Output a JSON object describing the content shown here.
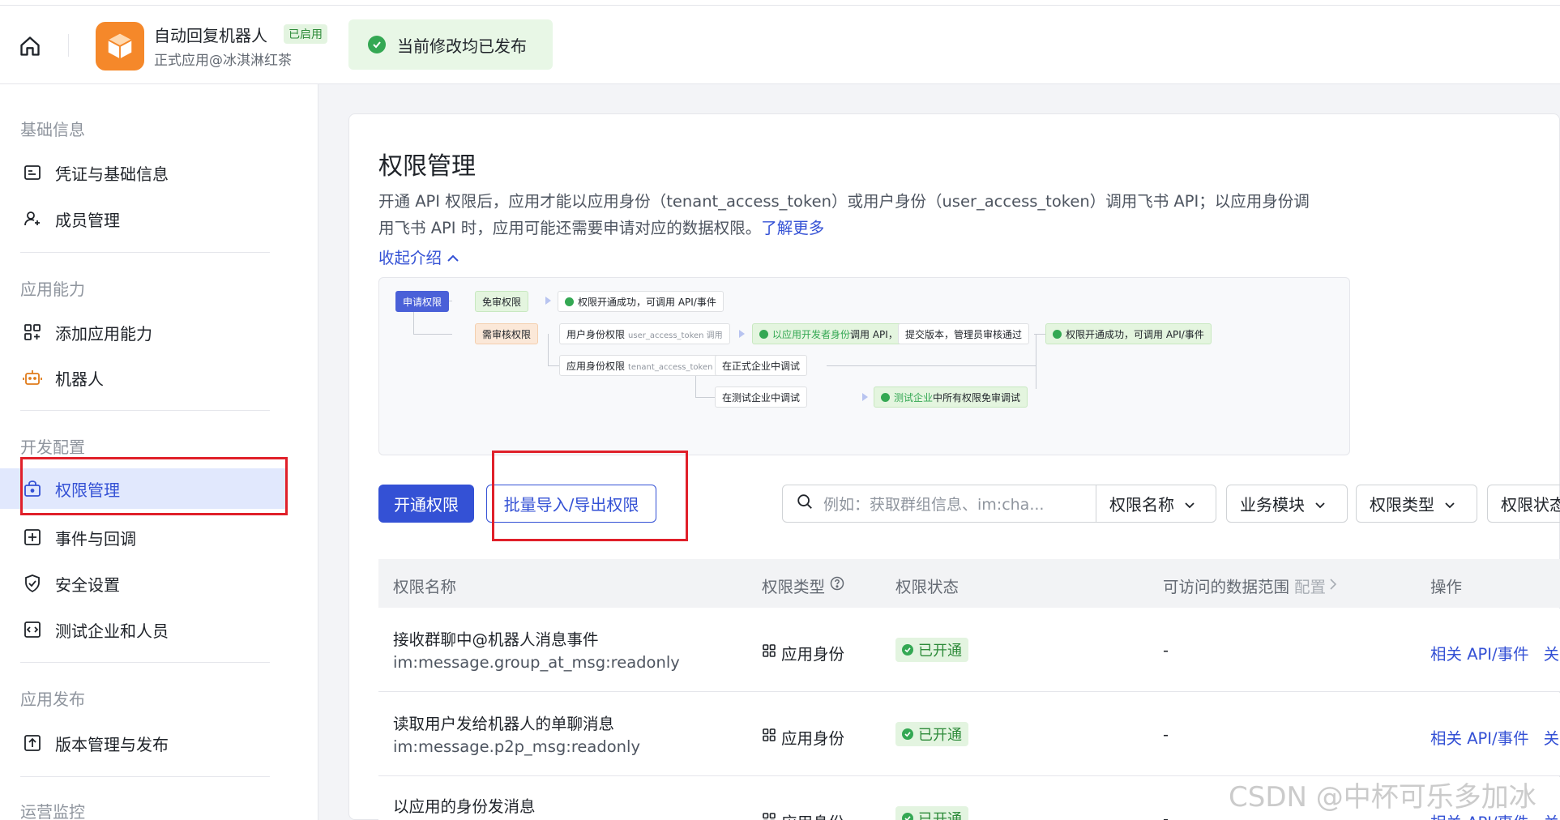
{
  "header": {
    "app_name": "自动回复机器人",
    "app_badge": "已启用",
    "app_owner": "正式应用@冰淇淋红茶",
    "publish_status": "当前修改均已发布"
  },
  "sidebar": {
    "groups": [
      {
        "label": "基础信息",
        "items": [
          {
            "label": "凭证与基础信息"
          },
          {
            "label": "成员管理"
          }
        ]
      },
      {
        "label": "应用能力",
        "items": [
          {
            "label": "添加应用能力"
          },
          {
            "label": "机器人"
          }
        ]
      },
      {
        "label": "开发配置",
        "items": [
          {
            "label": "权限管理"
          },
          {
            "label": "事件与回调"
          },
          {
            "label": "安全设置"
          },
          {
            "label": "测试企业和人员"
          }
        ]
      },
      {
        "label": "应用发布",
        "items": [
          {
            "label": "版本管理与发布"
          }
        ]
      },
      {
        "label": "运营监控",
        "items": []
      }
    ]
  },
  "main": {
    "title": "权限管理",
    "intro_line1": "开通 API 权限后，应用才能以应用身份（tenant_access_token）或用户身份（user_access_token）调用飞书 API；以应用身份调",
    "intro_line2": "用飞书 API 时，应用可能还需要申请对应的数据权限。",
    "learn_more": "了解更多",
    "collapse_label": "收起介绍",
    "flow": {
      "apply": "申请权限",
      "no_review": "免审权限",
      "no_review_result": "权限开通成功，可调用 API/事件",
      "need_review": "需审核权限",
      "user_perm": "用户身份权限",
      "user_perm_sub": "user_access_token 调用",
      "dev_call_a": "以应用开发者身份",
      "dev_call_b": "调用 API，免审核即可调试",
      "submit": "提交版本，管理员审核通过",
      "final_result": "权限开通成功，可调用 API/事件",
      "app_perm": "应用身份权限",
      "app_perm_sub": "tenant_access_token 调用",
      "prod_debug": "在正式企业中调试",
      "test_debug": "在测试企业中调试",
      "test_all_a": "测试企业",
      "test_all_b": "中所有权限免审调试"
    },
    "toolbar": {
      "enable_btn": "开通权限",
      "batch_btn": "批量导入/导出权限",
      "search_placeholder": "例如：获取群组信息、im:cha...",
      "filter_name": "权限名称",
      "filter_module": "业务模块",
      "filter_type": "权限类型",
      "filter_status": "权限状态"
    },
    "table": {
      "headers": {
        "name": "权限名称",
        "type": "权限类型",
        "status": "权限状态",
        "scope": "可访问的数据范围",
        "scope_config": "配置",
        "ops": "操作"
      },
      "rows": [
        {
          "name": "接收群聊中@机器人消息事件",
          "code": "im:message.group_at_msg:readonly",
          "type": "应用身份",
          "status": "已开通",
          "scope": "-",
          "link": "相关 API/事件",
          "extra": "关"
        },
        {
          "name": "读取用户发给机器人的单聊消息",
          "code": "im:message.p2p_msg:readonly",
          "type": "应用身份",
          "status": "已开通",
          "scope": "-",
          "link": "相关 API/事件",
          "extra": "关"
        },
        {
          "name": "以应用的身份发消息",
          "code": "",
          "type": "应用身份",
          "status": "已开通",
          "scope": "-",
          "link": "相关 API/事件",
          "extra": "关"
        }
      ]
    }
  },
  "watermark": "CSDN @中杯可乐多加冰",
  "colors": {
    "accent": "#3451d5",
    "success": "#34a853",
    "annotation": "#e0202a"
  }
}
